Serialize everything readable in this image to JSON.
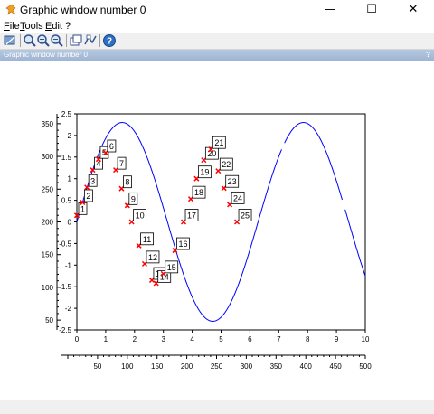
{
  "window": {
    "title": "Graphic window number 0",
    "minimize_glyph": "—",
    "maximize_glyph": "☐",
    "close_glyph": "✕"
  },
  "menu": {
    "items": [
      {
        "label": "File"
      },
      {
        "label": "Tools"
      },
      {
        "label": "Edit"
      },
      {
        "label": "?"
      }
    ]
  },
  "toolbar": {
    "buttons": [
      {
        "icon": "rotate-icon"
      },
      {
        "icon": "zoom-icon"
      },
      {
        "icon": "zoom-in-icon"
      },
      {
        "icon": "zoom-out-icon"
      },
      {
        "icon": "select-figure-icon"
      },
      {
        "icon": "datatip-icon"
      },
      {
        "icon": "help-icon"
      }
    ]
  },
  "dock": {
    "title": "Graphic window number 0",
    "help_glyph": "?"
  },
  "colors": {
    "curve": "#0000ff",
    "marker": "#ff0000"
  },
  "chart_data": {
    "type": "line",
    "title": "",
    "x_bottom": {
      "ticks": [
        0,
        1,
        2,
        3,
        4,
        5,
        6,
        7,
        8,
        9,
        10
      ],
      "range": [
        0,
        10
      ]
    },
    "x_outer": {
      "ticks": [
        50,
        100,
        150,
        200,
        250,
        300,
        350,
        400,
        450,
        500
      ],
      "range": [
        0,
        500
      ]
    },
    "y_left": {
      "ticks": [
        -2.5,
        -2,
        -1.5,
        -1,
        -0.5,
        0,
        0.5,
        1,
        1.5,
        2,
        2.5
      ],
      "range": [
        -2.5,
        2.5
      ]
    },
    "y_outer": {
      "ticks": [
        50,
        100,
        150,
        200,
        250,
        300,
        350
      ],
      "range": [
        35,
        365
      ]
    },
    "grid": false,
    "series": [
      {
        "function": "2.3*sin(x)",
        "x_range": [
          0,
          10
        ],
        "color": "#0000ff",
        "gaps": [
          [
            7.1,
            7.2
          ],
          [
            9.2,
            9.3
          ]
        ]
      }
    ],
    "datatips": [
      {
        "label": "1",
        "x": 0.0,
        "y": 0.15
      },
      {
        "label": "2",
        "x": 0.2,
        "y": 0.45
      },
      {
        "label": "3",
        "x": 0.35,
        "y": 0.8
      },
      {
        "label": "4",
        "x": 0.55,
        "y": 1.2
      },
      {
        "label": "5",
        "x": 0.75,
        "y": 1.45
      },
      {
        "label": "6",
        "x": 1.0,
        "y": 1.6
      },
      {
        "label": "7",
        "x": 1.35,
        "y": 1.2
      },
      {
        "label": "8",
        "x": 1.55,
        "y": 0.77
      },
      {
        "label": "9",
        "x": 1.75,
        "y": 0.38
      },
      {
        "label": "10",
        "x": 1.9,
        "y": 0.0
      },
      {
        "label": "11",
        "x": 2.15,
        "y": -0.55
      },
      {
        "label": "12",
        "x": 2.35,
        "y": -0.97
      },
      {
        "label": "13",
        "x": 2.6,
        "y": -1.35
      },
      {
        "label": "14",
        "x": 2.75,
        "y": -1.42
      },
      {
        "label": "15",
        "x": 3.0,
        "y": -1.2
      },
      {
        "label": "16",
        "x": 3.4,
        "y": -0.66
      },
      {
        "label": "17",
        "x": 3.7,
        "y": 0.0
      },
      {
        "label": "18",
        "x": 3.95,
        "y": 0.53
      },
      {
        "label": "19",
        "x": 4.15,
        "y": 1.0
      },
      {
        "label": "20",
        "x": 4.4,
        "y": 1.43
      },
      {
        "label": "21",
        "x": 4.65,
        "y": 1.68
      },
      {
        "label": "22",
        "x": 4.9,
        "y": 1.18
      },
      {
        "label": "23",
        "x": 5.1,
        "y": 0.78
      },
      {
        "label": "24",
        "x": 5.3,
        "y": 0.4
      },
      {
        "label": "25",
        "x": 5.55,
        "y": 0.0
      }
    ]
  }
}
